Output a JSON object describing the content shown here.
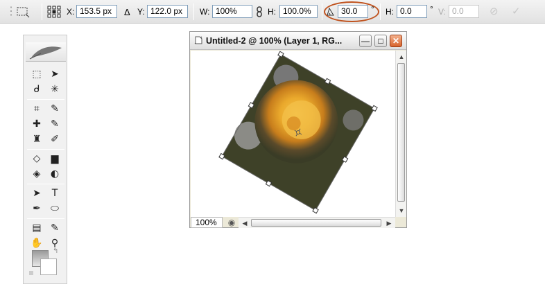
{
  "options_bar": {
    "x_label": "X:",
    "x_value": "153.5 px",
    "delta_label": "Δ",
    "y_label": "Y:",
    "y_value": "122.0 px",
    "w_label": "W:",
    "w_value": "100%",
    "h_label": "H:",
    "h_value": "100.0%",
    "angle_value": "30.0",
    "angle_unit": "°",
    "hskew_label": "H:",
    "hskew_value": "0.0",
    "hskew_unit": "°",
    "vskew_label": "V:",
    "vskew_value": "0.0",
    "annotation_color": "#c0531f"
  },
  "tools": [
    {
      "name": "rectangular-marquee-tool",
      "glyph": "⬚"
    },
    {
      "name": "move-tool",
      "glyph": "➤"
    },
    {
      "name": "lasso-tool",
      "glyph": "ᑯ"
    },
    {
      "name": "magic-wand-tool",
      "glyph": "✳"
    },
    {
      "name": "crop-tool",
      "glyph": "⌗"
    },
    {
      "name": "slice-tool",
      "glyph": "✎"
    },
    {
      "name": "healing-brush-tool",
      "glyph": "✚"
    },
    {
      "name": "brush-tool",
      "glyph": "✎"
    },
    {
      "name": "clone-stamp-tool",
      "glyph": "♜"
    },
    {
      "name": "history-brush-tool",
      "glyph": "✐"
    },
    {
      "name": "eraser-tool",
      "glyph": "◇"
    },
    {
      "name": "gradient-tool",
      "glyph": "▆"
    },
    {
      "name": "blur-tool",
      "glyph": "◈"
    },
    {
      "name": "dodge-tool",
      "glyph": "◐"
    },
    {
      "name": "path-selection-tool",
      "glyph": "➤"
    },
    {
      "name": "type-tool",
      "glyph": "T"
    },
    {
      "name": "pen-tool",
      "glyph": "✒"
    },
    {
      "name": "shape-tool",
      "glyph": "⬭"
    },
    {
      "name": "notes-tool",
      "glyph": "▤"
    },
    {
      "name": "eyedropper-tool",
      "glyph": "✎"
    },
    {
      "name": "hand-tool",
      "glyph": "✋"
    },
    {
      "name": "zoom-tool",
      "glyph": "⚲"
    }
  ],
  "document": {
    "title": "Untitled-2 @ 100% (Layer 1, RG...",
    "zoom": "100%",
    "rotation_degrees": 30
  }
}
